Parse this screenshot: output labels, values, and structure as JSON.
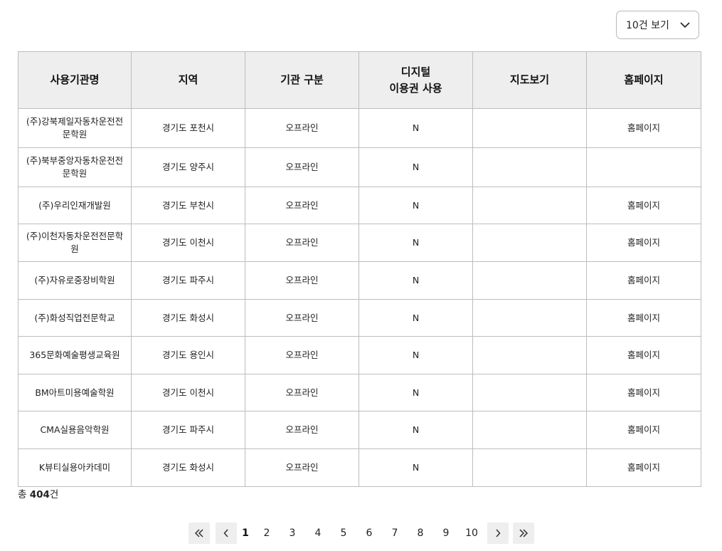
{
  "page_size": {
    "selected": "10건 보기"
  },
  "table": {
    "headers": [
      "사용기관명",
      "지역",
      "기관 구분",
      "디지털\n이용권 사용",
      "지도보기",
      "홈페이지"
    ],
    "rows": [
      {
        "name": "(주)강북제일자동차운전전문학원",
        "region": "경기도 포천시",
        "type": "오프라인",
        "digital": "N",
        "map": "",
        "home": "홈페이지"
      },
      {
        "name": "(주)북부중앙자동차운전전문학원",
        "region": "경기도 양주시",
        "type": "오프라인",
        "digital": "N",
        "map": "",
        "home": ""
      },
      {
        "name": "(주)우리인재개발원",
        "region": "경기도 부천시",
        "type": "오프라인",
        "digital": "N",
        "map": "",
        "home": "홈페이지"
      },
      {
        "name": "(주)이천자동차운전전문학원",
        "region": "경기도 이천시",
        "type": "오프라인",
        "digital": "N",
        "map": "",
        "home": "홈페이지"
      },
      {
        "name": "(주)자유로중장비학원",
        "region": "경기도 파주시",
        "type": "오프라인",
        "digital": "N",
        "map": "",
        "home": "홈페이지"
      },
      {
        "name": "(주)화성직업전문학교",
        "region": "경기도 화성시",
        "type": "오프라인",
        "digital": "N",
        "map": "",
        "home": "홈페이지"
      },
      {
        "name": "365문화예술평생교육원",
        "region": "경기도 용인시",
        "type": "오프라인",
        "digital": "N",
        "map": "",
        "home": "홈페이지"
      },
      {
        "name": "BM아트미용예술학원",
        "region": "경기도 이천시",
        "type": "오프라인",
        "digital": "N",
        "map": "",
        "home": "홈페이지"
      },
      {
        "name": "CMA실용음악학원",
        "region": "경기도 파주시",
        "type": "오프라인",
        "digital": "N",
        "map": "",
        "home": "홈페이지"
      },
      {
        "name": "K뷰티실용아카데미",
        "region": "경기도 화성시",
        "type": "오프라인",
        "digital": "N",
        "map": "",
        "home": "홈페이지"
      }
    ]
  },
  "total": {
    "prefix": "총 ",
    "count": "404",
    "suffix": "건"
  },
  "pagination": {
    "pages": [
      "1",
      "2",
      "3",
      "4",
      "5",
      "6",
      "7",
      "8",
      "9",
      "10"
    ],
    "current": "1"
  },
  "icons": {
    "dropdown": "chevron-down-icon",
    "first": "double-chevron-left-icon",
    "prev": "chevron-left-icon",
    "next": "chevron-right-icon",
    "last": "double-chevron-right-icon"
  }
}
